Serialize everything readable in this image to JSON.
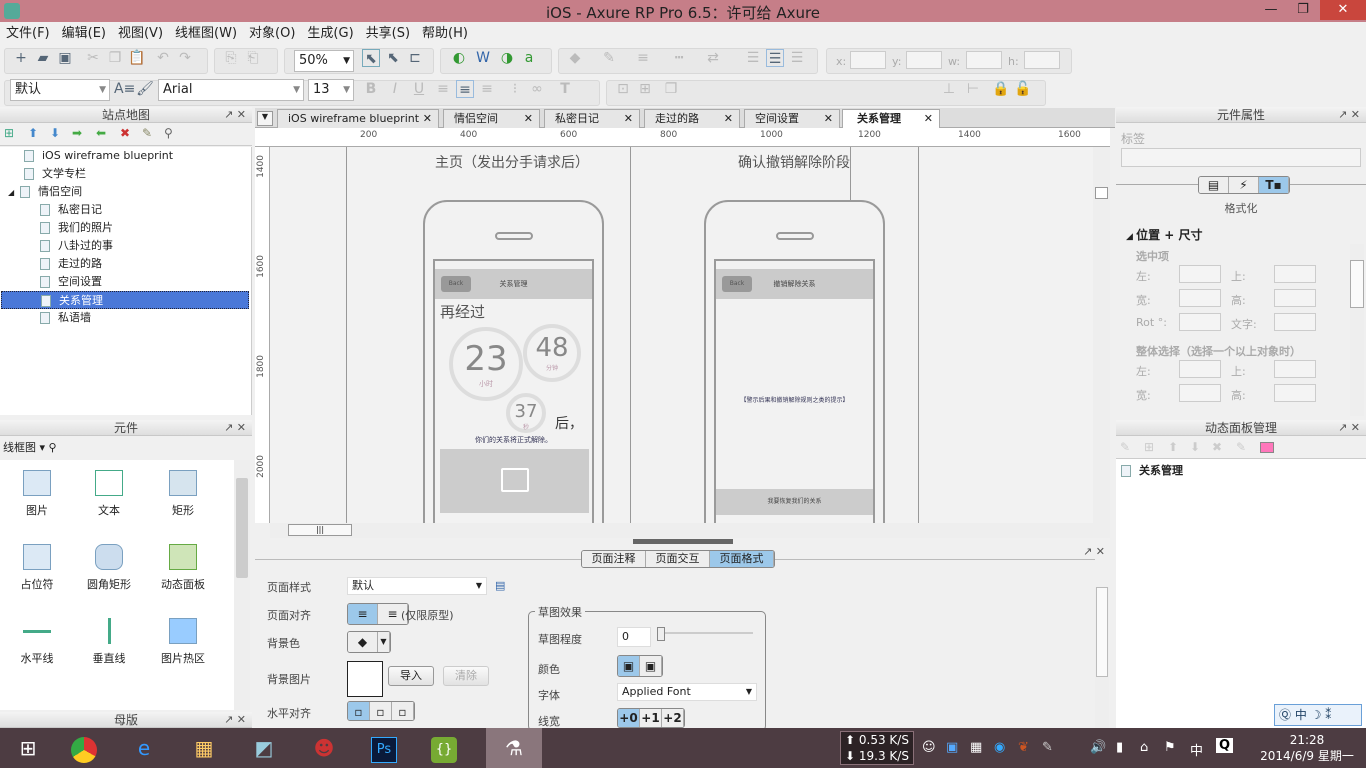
{
  "app": {
    "title": "iOS - Axure RP Pro 6.5：许可给 Axure"
  },
  "menu": [
    "文件(F)",
    "编辑(E)",
    "视图(V)",
    "线框图(W)",
    "对象(O)",
    "生成(G)",
    "共享(S)",
    "帮助(H)"
  ],
  "toolbar": {
    "zoom": "50%",
    "style": "默认",
    "font": "Arial",
    "font_size": "13",
    "x_label": "x:",
    "y_label": "y:",
    "w_label": "w:",
    "h_label": "h:"
  },
  "sitemap": {
    "title": "站点地图",
    "items": [
      {
        "label": "iOS wireframe blueprint",
        "level": 0
      },
      {
        "label": "文学专栏",
        "level": 0
      },
      {
        "label": "情侣空间",
        "level": 0,
        "expanded": true
      },
      {
        "label": "私密日记",
        "level": 1
      },
      {
        "label": "我们的照片",
        "level": 1
      },
      {
        "label": "八卦过的事",
        "level": 1
      },
      {
        "label": "走过的路",
        "level": 1
      },
      {
        "label": "空间设置",
        "level": 1
      },
      {
        "label": "关系管理",
        "level": 1,
        "selected": true
      },
      {
        "label": "私语墙",
        "level": 1
      }
    ]
  },
  "widgets": {
    "title": "元件",
    "library": "线框图",
    "items": [
      "图片",
      "文本",
      "矩形",
      "占位符",
      "圆角矩形",
      "动态面板",
      "水平线",
      "垂直线",
      "图片热区"
    ],
    "masters_title": "母版"
  },
  "tabs": [
    {
      "label": "iOS wireframe blueprint"
    },
    {
      "label": "情侣空间"
    },
    {
      "label": "私密日记"
    },
    {
      "label": "走过的路"
    },
    {
      "label": "空间设置"
    },
    {
      "label": "关系管理",
      "active": true
    }
  ],
  "ruler": {
    "h": [
      "200",
      "400",
      "600",
      "800",
      "1000",
      "1200",
      "1400",
      "1600"
    ],
    "v": [
      "1400",
      "1600",
      "1800",
      "2000"
    ]
  },
  "canvas": {
    "page1": {
      "heading": "主页（发出分手请求后）",
      "nav_title": "关系管理",
      "back": "Back",
      "intro": "再经过",
      "hours": "23",
      "hours_unit": "小时",
      "minutes": "48",
      "minutes_unit": "分钟",
      "seconds": "37",
      "seconds_unit": "秒",
      "after": "后，",
      "message": "你们的关系将正式解除。"
    },
    "page2": {
      "heading": "确认撤销解除阶段",
      "nav_title": "撤销解除关系",
      "back": "Back",
      "hint": "【警示后果和撤销解除规则之类的提示】",
      "button": "我要恢复我们的关系"
    }
  },
  "bottom": {
    "tabs": [
      "页面注释",
      "页面交互",
      "页面格式"
    ],
    "active_tab": "页面格式",
    "page_style_label": "页面样式",
    "page_style": "默认",
    "page_align_label": "页面对齐",
    "page_align_note": "(仅限原型)",
    "bg_color_label": "背景色",
    "bg_image_label": "背景图片",
    "import": "导入",
    "clear": "清除",
    "h_align_label": "水平对齐",
    "sketch": {
      "title": "草图效果",
      "degree_label": "草图程度",
      "degree": "0",
      "color_label": "颜色",
      "font_label": "字体",
      "font": "Applied Font",
      "line_label": "线宽",
      "line_opts": [
        "+0",
        "+1",
        "+2"
      ]
    }
  },
  "props": {
    "title": "元件属性",
    "label_caption": "标签",
    "section": "格式化",
    "group": "位置 + 尺寸",
    "selected": "选中项",
    "left": "左:",
    "top": "上:",
    "width": "宽:",
    "height": "高:",
    "rot": "Rot °:",
    "text": "文字:",
    "multi": "整体选择（选择一个以上对象时）"
  },
  "dynpanel": {
    "title": "动态面板管理",
    "item": "关系管理"
  },
  "taskbar": {
    "up": "0.53 K/S",
    "down": "19.3 K/S",
    "ime": "中",
    "time": "21:28",
    "date": "2014/6/9 星期一"
  },
  "ime_bar": {
    "mode": "中"
  },
  "colors": {
    "titlebar": "#c67e88",
    "selected": "#4a78d8",
    "accent": "#9cc8ea"
  }
}
